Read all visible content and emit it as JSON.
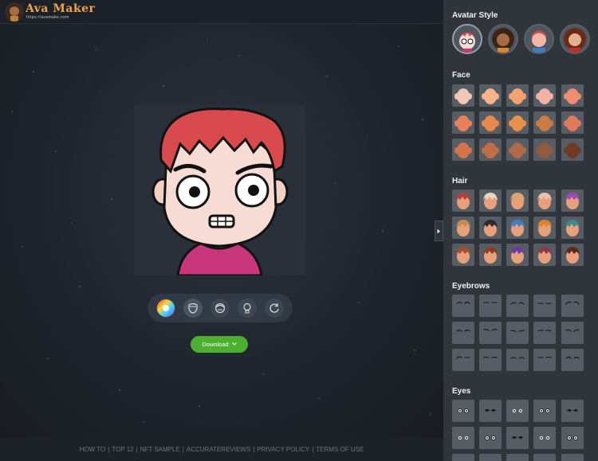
{
  "app": {
    "title": "Ava Maker",
    "url": "https://avamake.com"
  },
  "stage": {
    "download_label": "Download",
    "tools": [
      "color-wheel-icon",
      "face-icon",
      "hair-icon",
      "bulb-icon",
      "refresh-icon"
    ]
  },
  "footer": {
    "links": [
      "HOW TO",
      "TOP 12",
      "NFT SAMPLE",
      "ACCURATEREVIEWS",
      "PRIVACY POLICY",
      "TERMS OF USE"
    ]
  },
  "panel": {
    "sections": {
      "avatar_style": "Avatar Style",
      "face": "Face",
      "hair": "Hair",
      "eyebrows": "Eyebrows",
      "eyes": "Eyes"
    },
    "face_colors": [
      "#f3c7b5",
      "#f6b58a",
      "#f4a36f",
      "#f2b3a6",
      "#f08c6f",
      "#e9805c",
      "#e9884d",
      "#e8904a",
      "#c97c44",
      "#e0785a",
      "#d2744a",
      "#c26e45",
      "#b06a46",
      "#8f5a3d",
      "#6e3a23"
    ],
    "hair_colors": [
      "#b0413e",
      "#e7d6c2",
      "#e0a070",
      "#f2c0b0",
      "#9b4bb0",
      "#c58a50",
      "#2b2b2b",
      "#3e7fc0",
      "#e08030",
      "#3a8a8a",
      "#a05030",
      "#8a4020",
      "#6a3da0",
      "#8a3a4a",
      "#5a2a1a"
    ],
    "colors": {
      "accent": "#4caf2f",
      "brand": "#f0a544",
      "avatar_hair": "#d94a4f",
      "avatar_shirt": "#c8357a"
    }
  }
}
